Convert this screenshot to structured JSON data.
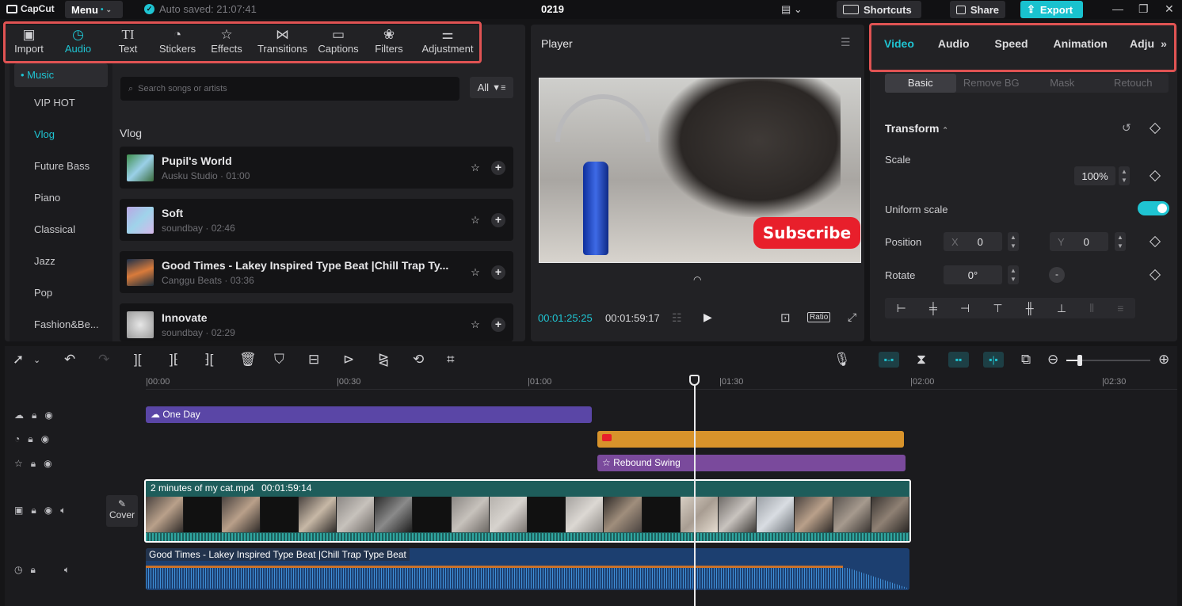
{
  "topbar": {
    "logo": "CapCut",
    "menu_label": "Menu",
    "autosave": "Auto saved: 21:07:41",
    "project_name": "0219",
    "shortcuts": "Shortcuts",
    "share": "Share",
    "export": "Export"
  },
  "media_toolbar": [
    {
      "label": "Import",
      "icon": "import-icon"
    },
    {
      "label": "Audio",
      "icon": "audio-icon"
    },
    {
      "label": "Text",
      "icon": "text-icon"
    },
    {
      "label": "Stickers",
      "icon": "stickers-icon"
    },
    {
      "label": "Effects",
      "icon": "effects-icon"
    },
    {
      "label": "Transitions",
      "icon": "transitions-icon"
    },
    {
      "label": "Captions",
      "icon": "captions-icon"
    },
    {
      "label": "Filters",
      "icon": "filters-icon"
    },
    {
      "label": "Adjustment",
      "icon": "adjustment-icon"
    }
  ],
  "audio_sidebar": [
    "Music",
    "VIP HOT",
    "Vlog",
    "Future Bass",
    "Piano",
    "Classical",
    "Jazz",
    "Pop",
    "Fashion&Be..."
  ],
  "search": {
    "placeholder": "Search songs or artists",
    "filter": "All"
  },
  "section_title": "Vlog",
  "tracks": [
    {
      "title": "Pupil's World",
      "meta": "Ausku Studio · 01:00"
    },
    {
      "title": "Soft",
      "meta": "soundbay · 02:46"
    },
    {
      "title": "Good Times - Lakey Inspired Type Beat |Chill Trap Ty...",
      "meta": "Canggu Beats · 03:36"
    },
    {
      "title": "Innovate",
      "meta": "soundbay · 02:29"
    }
  ],
  "player": {
    "title": "Player",
    "overlay_text": "Subscribe",
    "current_time": "00:01:25:25",
    "total_time": "00:01:59:17",
    "ratio": "Ratio"
  },
  "props": {
    "tabs": [
      "Video",
      "Audio",
      "Speed",
      "Animation",
      "Adju"
    ],
    "subtabs": [
      "Basic",
      "Remove BG",
      "Mask",
      "Retouch"
    ],
    "transform_title": "Transform",
    "scale_label": "Scale",
    "scale_value": "100%",
    "uniform_label": "Uniform scale",
    "position_label": "Position",
    "pos_x_label": "X",
    "pos_x": "0",
    "pos_y_label": "Y",
    "pos_y": "0",
    "rotate_label": "Rotate",
    "rotate_value": "0°"
  },
  "timeline": {
    "ruler": [
      "|00:00",
      "|00:30",
      "|01:00",
      "|01:30",
      "|02:00",
      "|02:30"
    ],
    "text_clip": "One Day",
    "effect_clip": "Rebound Swing",
    "video_clip_name": "2 minutes of my cat.mp4",
    "video_clip_duration": "00:01:59:14",
    "cover_label": "Cover",
    "audio_clip": "Good Times - Lakey Inspired Type Beat |Chill Trap Type Beat"
  },
  "colors": {
    "accent": "#1fc4d2",
    "highlight_box": "#e05353",
    "text_clip": "#5a46a6",
    "sticker_clip": "#d8932b",
    "effect_clip": "#7a4a9c",
    "video_clip": "#1e5d5b",
    "audio_clip": "#1c3f70"
  }
}
